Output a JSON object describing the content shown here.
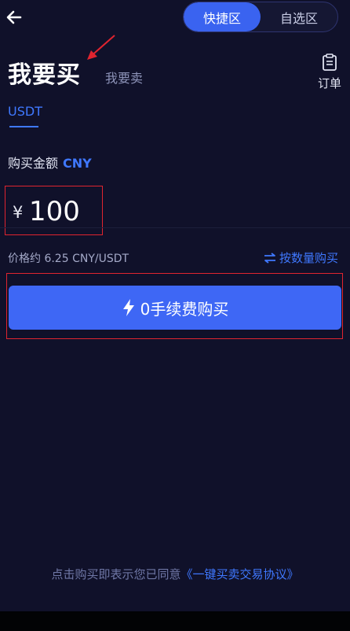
{
  "header": {
    "segments": [
      {
        "label": "快捷区",
        "active": true
      },
      {
        "label": "自选区",
        "active": false
      }
    ]
  },
  "title": {
    "buy": "我要买",
    "sell": "我要卖"
  },
  "order": {
    "label": "订单"
  },
  "coin_tab": {
    "label": "USDT"
  },
  "amount": {
    "label": "购买金额",
    "currency": "CNY",
    "symbol": "¥",
    "value": "100"
  },
  "price": {
    "text": "价格约 6.25 CNY/USDT"
  },
  "switch_mode": {
    "label": "按数量购买"
  },
  "buy_button": {
    "label": "0手续费购买"
  },
  "agreement": {
    "prefix": "点击购买即表示您已同意",
    "link": "《一键买卖交易协议》"
  },
  "colors": {
    "accent": "#3e67f5",
    "background": "#10112a",
    "annotation": "#e0242f"
  }
}
